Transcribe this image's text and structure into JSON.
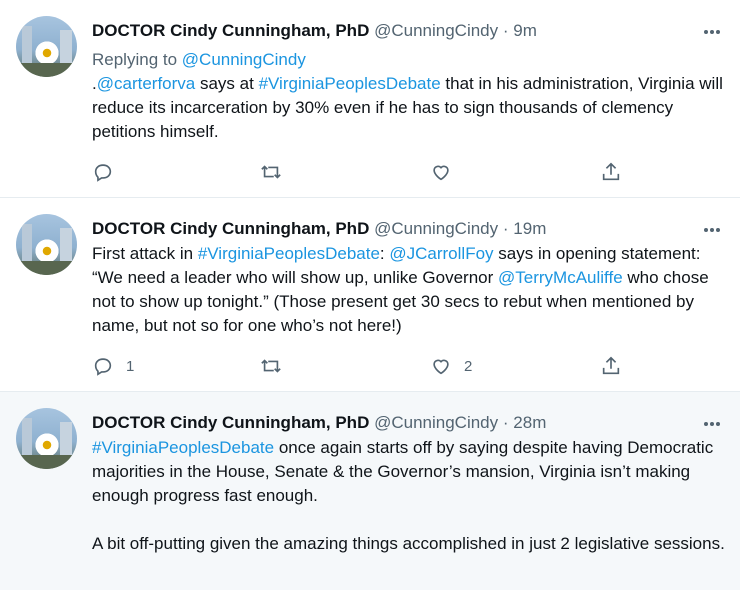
{
  "tweets": [
    {
      "name": "DOCTOR Cindy Cunningham, PhD",
      "handle": "@CunningCindy",
      "sep": "·",
      "time": "9m",
      "reply_prefix": "Replying to ",
      "reply_to": "@CunningCindy",
      "text": {
        "p0": ".",
        "m1": "@carterforva",
        "p1": " says at ",
        "h1": "#VirginiaPeoplesDebate",
        "p2": " that in his administration, Virginia will reduce its incarceration by 30% even if he has to sign thousands of clemency petitions himself."
      },
      "reply_count": "",
      "retweet_count": "",
      "like_count": ""
    },
    {
      "name": "DOCTOR Cindy Cunningham, PhD",
      "handle": "@CunningCindy",
      "sep": "·",
      "time": "19m",
      "text": {
        "p0": "First attack in ",
        "h1": "#VirginiaPeoplesDebate",
        "p1": ": ",
        "m1": "@JCarrollFoy",
        "p2": " says in opening statement: “We need a leader who will show up, unlike Governor ",
        "m2": "@TerryMcAuliffe",
        "p3": " who chose not to show up tonight.” (Those present get 30 secs to rebut when mentioned by name, but not so for one who’s not here!)"
      },
      "reply_count": "1",
      "retweet_count": "",
      "like_count": "2"
    },
    {
      "name": "DOCTOR Cindy Cunningham, PhD",
      "handle": "@CunningCindy",
      "sep": "·",
      "time": "28m",
      "text": {
        "h1": "#VirginiaPeoplesDebate",
        "p1": " once again starts off by saying despite having Democratic majorities in the House, Senate & the Governor’s mansion, Virginia isn’t making enough progress fast enough.",
        "p2": "A bit off-putting given the amazing things accomplished in just 2 legislative sessions."
      }
    }
  ],
  "colors": {
    "link": "#1b95e0",
    "muted": "#536471",
    "text": "#0f1419",
    "highlight_bg": "#f5f8fa"
  },
  "icons": [
    "reply-icon",
    "retweet-icon",
    "like-icon",
    "share-icon",
    "more-icon"
  ]
}
